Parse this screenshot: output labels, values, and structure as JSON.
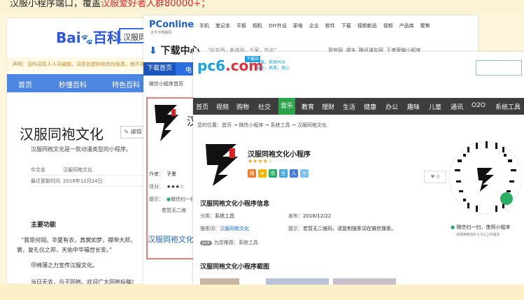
{
  "banner": {
    "prefix": "汉服小程序端口，覆盖",
    "highlight": "汉服爱好者人群80000+；"
  },
  "baike": {
    "logo_prefix": "Bai",
    "logo_suffix": "百科",
    "search_value": "汉服同",
    "notice": "声明：百科词条人人可编辑，词条创建和修改均免费，绝不存在官方及代理商付费代编，请勿上当受骗。",
    "nav": [
      "首页",
      "秒懂百科",
      "特色百科"
    ],
    "title": "汉服同袍文化",
    "edit_label": "编辑",
    "summary": "汉服同袍文化是一款动漫类型的小程序。",
    "info": [
      {
        "k": "中文名",
        "v": "汉服同袍文化"
      },
      {
        "k": "最近更新时间",
        "v": "2018年12月24日"
      }
    ],
    "section_title": "主要功能",
    "paragraphs": [
      "“我思何翊，华夏有衣，真裳如梦，襟带大邦，",
      "裳，复礼仪之邦，天佑中华福世长安。”",
      "尽绵薄之力宣传汉服文化。",
      "当日无衣，与子同袍。欢迎广大同袍投稿！"
    ]
  },
  "pconline": {
    "brand": "PConline",
    "brand_sub": "太平洋电脑网",
    "topnav": [
      "手机",
      "笔记本",
      "平板",
      "相机",
      "DIY外设",
      "家电",
      "企业",
      "软件",
      "下载",
      "视频新品",
      "视频",
      "产品库",
      "聚焦"
    ],
    "dl_title": "下载中心",
    "dl_sub": "“好东西，新体验，千家，在此”",
    "links": [
      "哥官网",
      "顺丰",
      "腾讯课车网",
      "王者荣耀小程序"
    ],
    "bluebar": [
      "下载首页",
      "电"
    ],
    "crumb": "微信小程序首页",
    "sidebar": [
      {
        "k": "作者：",
        "v": "子墨"
      },
      {
        "k": "评分：",
        "v": "★★★☆"
      },
      {
        "k": "提示：",
        "v": "微信扫一扫"
      }
    ],
    "side_note": "若暂无二维",
    "side_title": "汉服同袍文化",
    "big_title": "汉"
  },
  "pc6": {
    "logo": "pc6",
    "logo_dot": ".com",
    "tag": "下载站",
    "slogan_1": "下载，就来PC6",
    "slogan_2": "安全，高速，放心",
    "nav": [
      "首页",
      "视频",
      "购物",
      "社交",
      "音乐",
      "教育",
      "理财",
      "生活",
      "健康",
      "办公",
      "趣味",
      "儿童",
      "通讯",
      "O2O",
      "系统工具"
    ],
    "active_nav": "音乐",
    "crumb": "您的位置：首页 → 微信小程序 → 系统工具 → 汉服同袍文化",
    "app_name": "汉服同袍文化小程序",
    "stars": "★★★★☆",
    "like": "0",
    "info_title": "汉服同袍文化小程序信息",
    "rows": [
      {
        "k": "分类：",
        "v": "系统工具"
      },
      {
        "k": "发布：",
        "v": "2018/12/22"
      },
      {
        "k": "搜索词：",
        "v": "汉服同袍文化"
      },
      {
        "k": "提示：",
        "v": "若暂无二维码，请复制搜索词在微信搜索。"
      }
    ],
    "recommend_pill": "pc6",
    "recommend_label": "为您推荐：",
    "recommend_value": "系统工具",
    "shots_title": "汉服同袍文化小程序截图",
    "qr_caption": "微信扫一扫，使用小程序",
    "qr_note": "请使用微信6.5.3以上的版本",
    "share_colors": [
      "#f07a2a",
      "#f4b400",
      "#2aae67",
      "#41a8e0",
      "#4a7ad8",
      "#7fc1f0"
    ]
  }
}
